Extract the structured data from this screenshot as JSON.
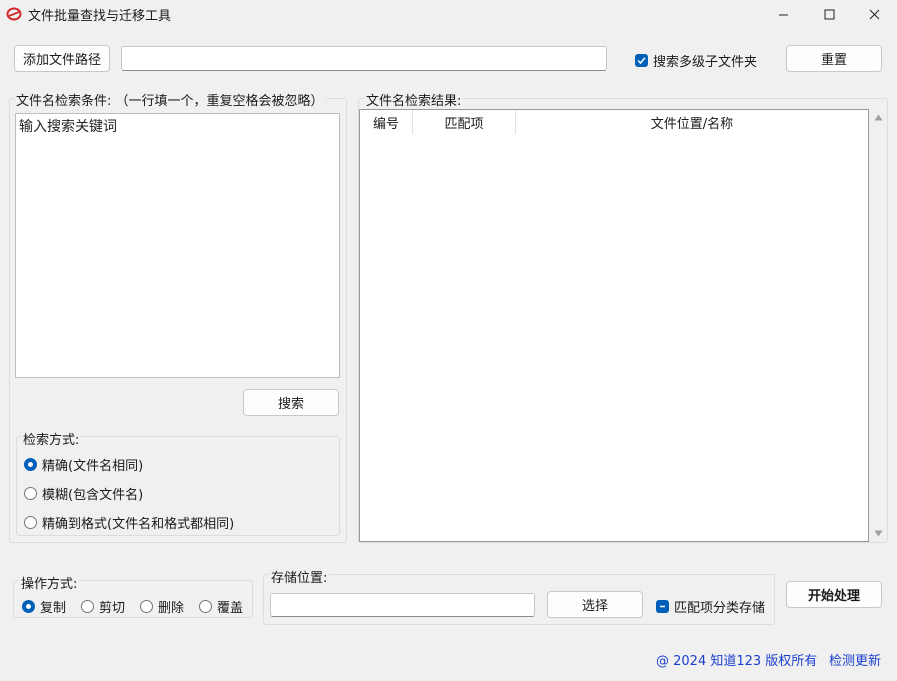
{
  "window": {
    "title": "文件批量查找与迁移工具",
    "controls": {
      "minimize": "—",
      "maximize": "☐",
      "close": "✕"
    }
  },
  "toolbar": {
    "add_path_label": "添加文件路径",
    "path_value": "",
    "search_subfolders_label": "搜索多级子文件夹",
    "search_subfolders_checked": true,
    "reset_label": "重置"
  },
  "conditions": {
    "label": "文件名检索条件: （一行填一个，重复空格会被忽略）",
    "text": "输入搜索关键词",
    "search_button": "搜索"
  },
  "search_mode": {
    "label": "检索方式:",
    "options": [
      {
        "label": "精确(文件名相同)",
        "selected": true
      },
      {
        "label": "模糊(包含文件名)",
        "selected": false
      },
      {
        "label": "精确到格式(文件名和格式都相同)",
        "selected": false
      }
    ]
  },
  "results": {
    "label": "文件名检索结果:",
    "columns": [
      "编号",
      "匹配项",
      "文件位置/名称"
    ],
    "rows": []
  },
  "operation": {
    "label": "操作方式:",
    "options": [
      {
        "label": "复制",
        "selected": true
      },
      {
        "label": "剪切",
        "selected": false
      },
      {
        "label": "删除",
        "selected": false
      },
      {
        "label": "覆盖",
        "selected": false
      }
    ]
  },
  "storage": {
    "label": "存储位置:",
    "path_value": "",
    "choose_button": "选择",
    "categorize_label": "匹配项分类存储",
    "categorize_state": "indeterminate"
  },
  "start_button": "开始处理",
  "footer": {
    "copyright": "@ 2024 知道123 版权所有",
    "check_update": "检测更新"
  },
  "colors": {
    "accent": "#005fb8",
    "link": "#1a3fcf",
    "background": "#f0f0f0"
  }
}
